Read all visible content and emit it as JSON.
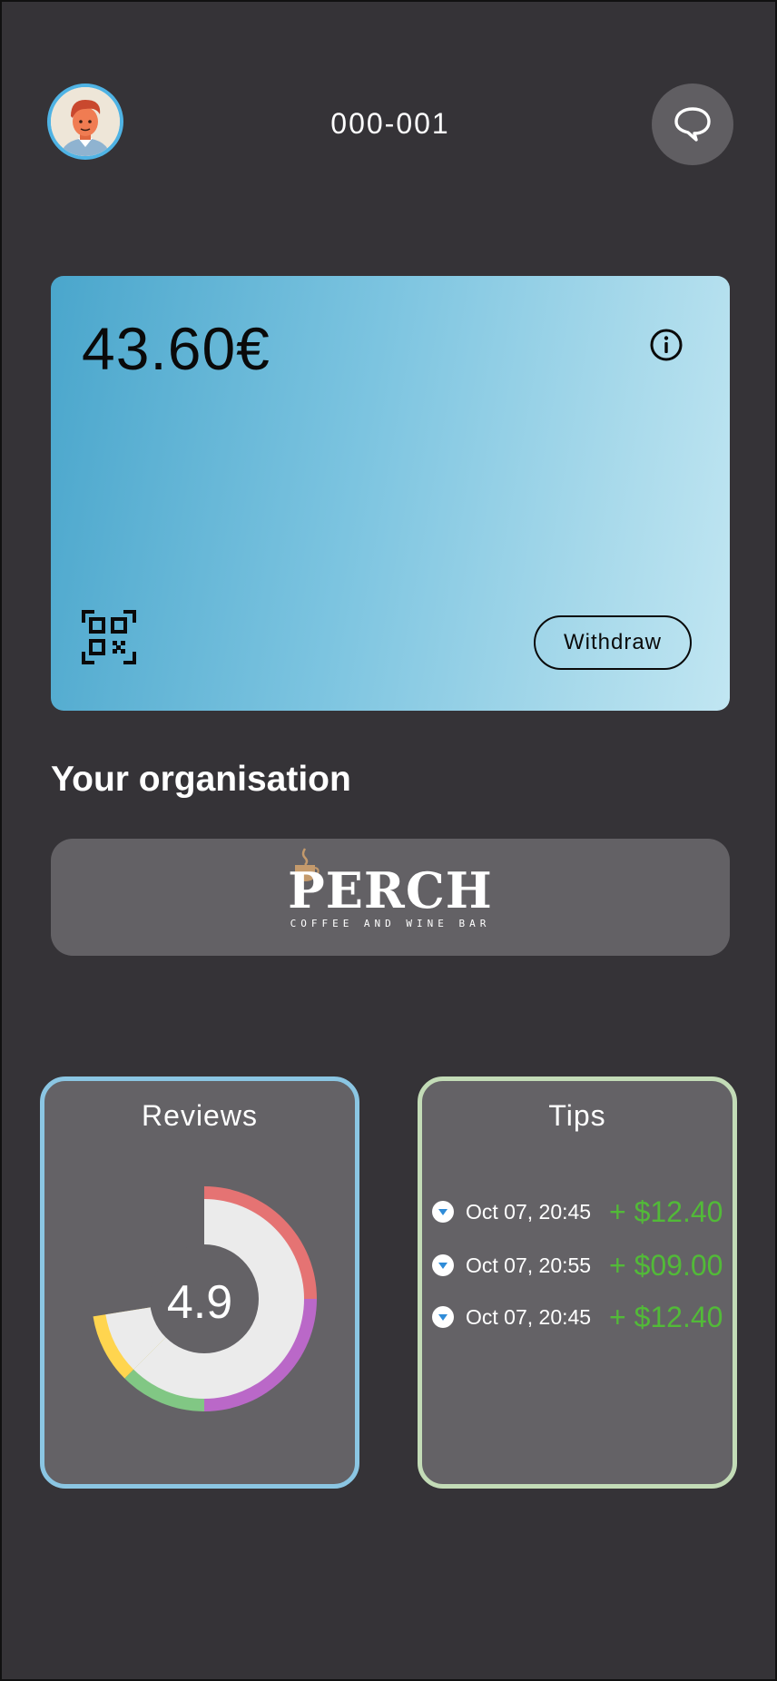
{
  "header": {
    "account_id": "000-001",
    "avatar_icon": "user-avatar-icon",
    "chat_icon": "chat-bubble-icon"
  },
  "balance_card": {
    "amount": "43.60€",
    "info_icon": "info-icon",
    "qr_icon": "qr-code-icon",
    "withdraw_label": "Withdraw",
    "colors": {
      "gradient_start": "#4AA6CC",
      "gradient_end": "#C1E6F2"
    }
  },
  "organisation": {
    "section_title": "Your organisation",
    "logo_name": "PERCH",
    "logo_tagline": "COFFEE AND WINE BAR"
  },
  "reviews": {
    "title": "Reviews",
    "score": "4.9",
    "segments": [
      {
        "color": "#E57373",
        "fraction": 0.25
      },
      {
        "color": "#BA68C8",
        "fraction": 0.25
      },
      {
        "color": "#81C784",
        "fraction": 0.125
      },
      {
        "color": "#FFD54F",
        "fraction": 0.1
      }
    ],
    "border_color": "#8BC6E3"
  },
  "tips": {
    "title": "Tips",
    "items": [
      {
        "date": "Oct 07, 20:45",
        "amount": "+ $12.40"
      },
      {
        "date": "Oct 07, 20:55",
        "amount": "+ $09.00"
      },
      {
        "date": "Oct 07, 20:45",
        "amount": "+ $12.40"
      }
    ],
    "amount_color": "#52BA38",
    "border_color": "#C3DCB7",
    "item_icon": "chevron-down-circle-icon"
  }
}
